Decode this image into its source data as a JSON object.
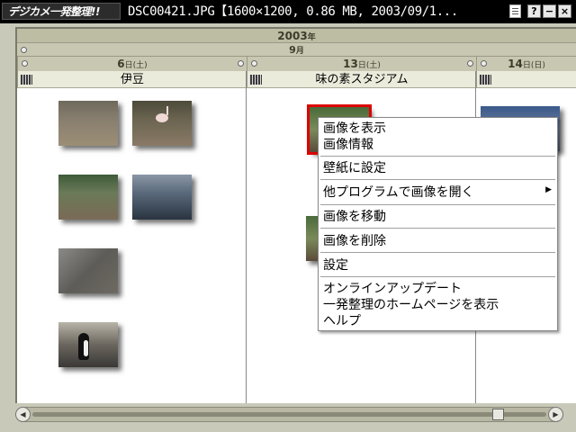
{
  "titlebar": {
    "app_name": "デジカメ一発整理!!",
    "file_info": "DSC00421.JPG【1600×1200, 0.86 MB, 2003/09/1...",
    "help_label": "?",
    "minimize_label": "−",
    "close_label": "×"
  },
  "timeline": {
    "year": "2003",
    "year_suffix": "年",
    "month": "9",
    "month_suffix": "月",
    "days": [
      {
        "day": "6",
        "suffix": "日",
        "weekday": "(土)",
        "place": "伊豆"
      },
      {
        "day": "13",
        "suffix": "日",
        "weekday": "(土)",
        "place": "味の素スタジアム"
      },
      {
        "day": "14",
        "suffix": "日",
        "weekday": "(日)",
        "place": ""
      }
    ]
  },
  "context_menu": {
    "items": [
      "画像を表示",
      "画像情報",
      "壁紙に設定",
      "他プログラムで画像を開く",
      "画像を移動",
      "画像を削除",
      "設定",
      "オンラインアップデート",
      "一発整理のホームページを表示",
      "ヘルプ"
    ],
    "submenu_arrow": "▶"
  },
  "scrollbar": {
    "left_arrow": "◀",
    "right_arrow": "▶"
  }
}
